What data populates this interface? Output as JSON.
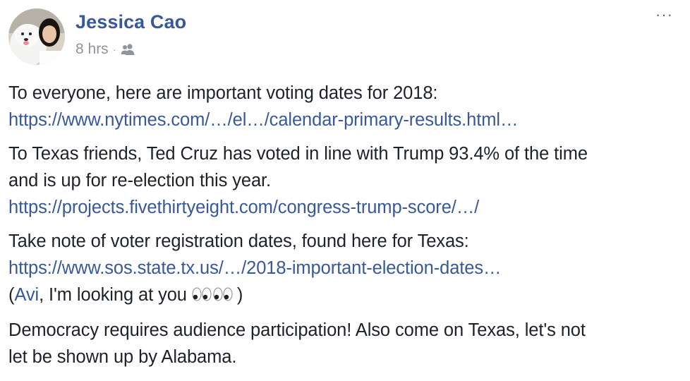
{
  "post": {
    "author": "Jessica Cao",
    "time": "8 hrs",
    "separator": "·",
    "audience_icon": "friends-icon",
    "more_label": "···",
    "paragraphs": [
      {
        "text": "To everyone, here are important voting dates for 2018:",
        "link": "https://www.nytimes.com/…/el…/calendar-primary-results.html…"
      },
      {
        "text_line1": "To Texas friends, Ted Cruz has voted in line with Trump 93.4% of the time",
        "text_line2": "and is up for re-election this year.",
        "link": "https://projects.fivethirtyeight.com/congress-trump-score/…/"
      },
      {
        "text": "Take note of voter registration dates, found here for Texas:",
        "link": "https://www.sos.state.tx.us/…/2018-important-election-dates…",
        "mention_prefix": "(",
        "mention": "Avi",
        "mention_suffix": ", I'm looking at you ",
        "emoji": "eyes-emoji",
        "closing": ")"
      },
      {
        "text_line1": "Democracy requires audience participation! Also come on Texas, let's not",
        "text_line2": "let be shown up by Alabama."
      }
    ]
  },
  "colors": {
    "link": "#385898",
    "meta": "#90949c",
    "text": "#1d2129"
  }
}
